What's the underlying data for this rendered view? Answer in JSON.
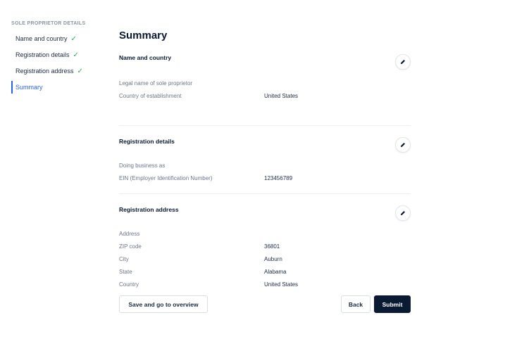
{
  "sidebar": {
    "heading": "SOLE PROPRIETOR DETAILS",
    "items": [
      {
        "label": "Name and country",
        "completed": true
      },
      {
        "label": "Registration details",
        "completed": true
      },
      {
        "label": "Registration address",
        "completed": true
      },
      {
        "label": "Summary",
        "completed": false,
        "active": true
      }
    ],
    "check_glyph": "✓"
  },
  "main": {
    "title": "Summary",
    "sections": {
      "name_country": {
        "title": "Name and country",
        "rows": [
          {
            "label": "Legal name of sole proprietor",
            "value": ""
          },
          {
            "label": "Country of establishment",
            "value": "United States"
          }
        ]
      },
      "registration_details": {
        "title": "Registration details",
        "rows": [
          {
            "label": "Doing business as",
            "value": ""
          },
          {
            "label": "EIN (Employer Identification Number)",
            "value": "123456789"
          }
        ]
      },
      "registration_address": {
        "title": "Registration address",
        "rows": [
          {
            "label": "Address",
            "value": ""
          },
          {
            "label": "ZIP code",
            "value": "36801"
          },
          {
            "label": "City",
            "value": "Auburn"
          },
          {
            "label": "State",
            "value": "Alabama"
          },
          {
            "label": "Country",
            "value": "United States"
          }
        ]
      }
    }
  },
  "actions": {
    "save_overview_label": "Save and go to overview",
    "back_label": "Back",
    "submit_label": "Submit"
  },
  "colors": {
    "accent": "#2563eb",
    "check": "#22b05a",
    "primary_button": "#0b1a33"
  },
  "icons": {
    "edit": "pencil-icon",
    "check": "check-icon"
  }
}
